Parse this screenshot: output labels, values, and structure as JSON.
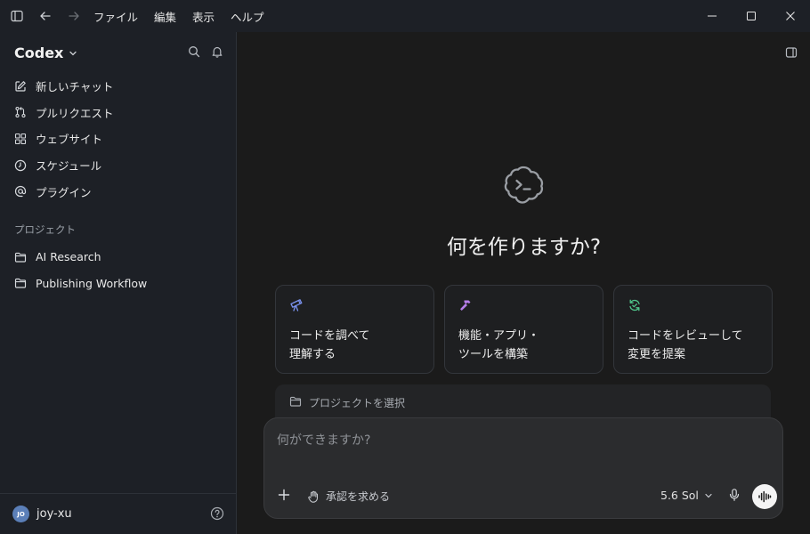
{
  "menu": {
    "items": [
      "ファイル",
      "編集",
      "表示",
      "ヘルプ"
    ]
  },
  "sidebar": {
    "brand": "Codex",
    "nav": [
      {
        "label": "新しいチャット",
        "icon": "edit-icon"
      },
      {
        "label": "プルリクエスト",
        "icon": "pull-request-icon"
      },
      {
        "label": "ウェブサイト",
        "icon": "grid-icon"
      },
      {
        "label": "スケジュール",
        "icon": "clock-icon"
      },
      {
        "label": "プラグイン",
        "icon": "at-icon"
      }
    ],
    "section_label": "プロジェクト",
    "projects": [
      {
        "label": "AI Research",
        "icon": "folder-icon"
      },
      {
        "label": "Publishing Workflow",
        "icon": "folder-icon"
      }
    ],
    "user": {
      "initials": "JO",
      "name": "joy-xu"
    }
  },
  "main": {
    "headline": "何を作りますか?",
    "cards": [
      {
        "text": "コードを調べて\n理解する",
        "icon": "telescope-icon",
        "color": "#7b93f0"
      },
      {
        "text": "機能・アプリ・\nツールを構築",
        "icon": "hammer-icon",
        "color": "#b57ee8"
      },
      {
        "text": "コードをレビューして\n変更を提案",
        "icon": "refresh-icon",
        "color": "#4fc38a"
      }
    ],
    "project_select": "プロジェクトを選択",
    "composer": {
      "placeholder": "何ができますか?",
      "approval": "承認を求める",
      "model": "5.6 Sol"
    }
  }
}
